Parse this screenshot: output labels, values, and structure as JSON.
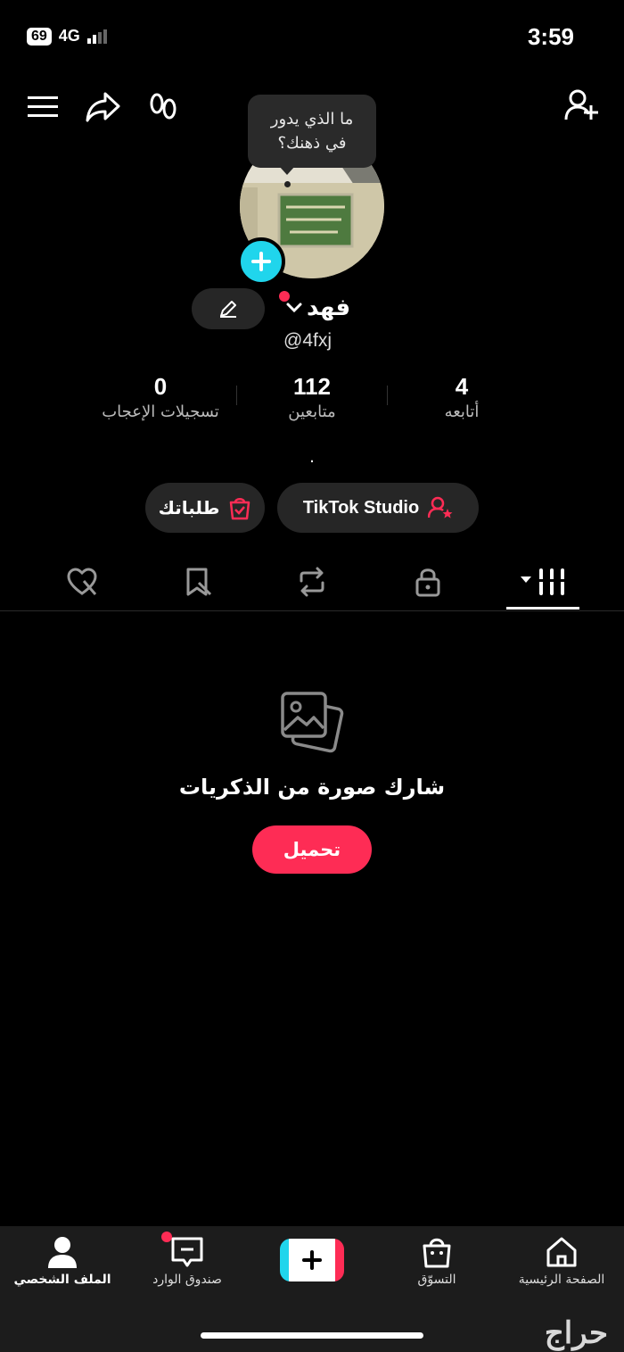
{
  "status_bar": {
    "time": "3:59",
    "battery": "69",
    "network": "4G"
  },
  "header": {
    "menu_icon": "hamburger-icon",
    "share_icon": "share-arrow-icon",
    "footprint_icon": "footprints-icon",
    "add_friend_icon": "add-user-icon"
  },
  "profile": {
    "note_line1": "ما الذي يدور",
    "note_line2": "في ذهنك؟",
    "display_name": "فهد",
    "username": "@4fxj",
    "stats": [
      {
        "value": "4",
        "label": "أتابعه"
      },
      {
        "value": "112",
        "label": "متابعين"
      },
      {
        "value": "0",
        "label": "تسجيلات الإعجاب"
      }
    ],
    "bio": "."
  },
  "actions": {
    "studio_label": "TikTok Studio",
    "orders_label": "طلباتك"
  },
  "tabs": [
    "videos-grid",
    "private",
    "reposts",
    "favorites",
    "liked"
  ],
  "empty_state": {
    "title": "شارك صورة من الذكريات",
    "button": "تحميل"
  },
  "bottom_nav": {
    "home": "الصفحة الرئيسية",
    "shop": "التسوّق",
    "inbox": "صندوق الوارد",
    "profile": "الملف الشخصي"
  },
  "watermark": "حراج",
  "colors": {
    "accent": "#fe2c55",
    "cyan": "#20d5ec",
    "background": "#000000"
  }
}
